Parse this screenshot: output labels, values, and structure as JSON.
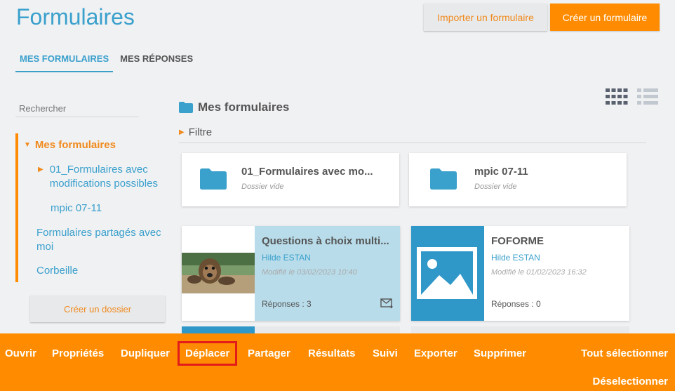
{
  "header": {
    "title": "Formulaires",
    "import_label": "Importer un formulaire",
    "create_label": "Créer un formulaire"
  },
  "tabs": [
    {
      "label": "MES FORMULAIRES",
      "active": true
    },
    {
      "label": "MES RÉPONSES",
      "active": false
    }
  ],
  "sidebar": {
    "search_placeholder": "Rechercher",
    "tree": {
      "root": "Mes formulaires",
      "sub1": "01_Formulaires avec modifications possibles",
      "sub2": "mpic 07-11",
      "shared": "Formulaires partagés avec moi",
      "trash": "Corbeille"
    },
    "create_folder_label": "Créer un dossier"
  },
  "main": {
    "section_title": "Mes formulaires",
    "filter_label": "Filtre",
    "folders": [
      {
        "name": "01_Formulaires avec mo...",
        "status": "Dossier vide"
      },
      {
        "name": "mpic 07-11",
        "status": "Dossier vide"
      }
    ],
    "forms": [
      {
        "title": "Questions à choix multi...",
        "author": "Hilde ESTAN",
        "modified": "Modifié le 03/02/2023 10:40",
        "responses": "Réponses : 3",
        "selected": true,
        "icon": "photo-thumbnail"
      },
      {
        "title": "FOFORME",
        "author": "Hilde ESTAN",
        "modified": "Modifié le 01/02/2023 16:32",
        "responses": "Réponses : 0",
        "selected": false,
        "icon": "image-placeholder-icon"
      }
    ]
  },
  "actions": {
    "open": "Ouvrir",
    "properties": "Propriétés",
    "duplicate": "Dupliquer",
    "move": "Déplacer",
    "share": "Partager",
    "results": "Résultats",
    "tracking": "Suivi",
    "export": "Exporter",
    "delete": "Supprimer",
    "select_all": "Tout sélectionner",
    "deselect": "Déselectionner"
  },
  "colors": {
    "accent_blue": "#3aa0cc",
    "accent_orange": "#ff8c00",
    "highlight_red": "#e21b1b",
    "selected_card": "#b8dcea"
  }
}
